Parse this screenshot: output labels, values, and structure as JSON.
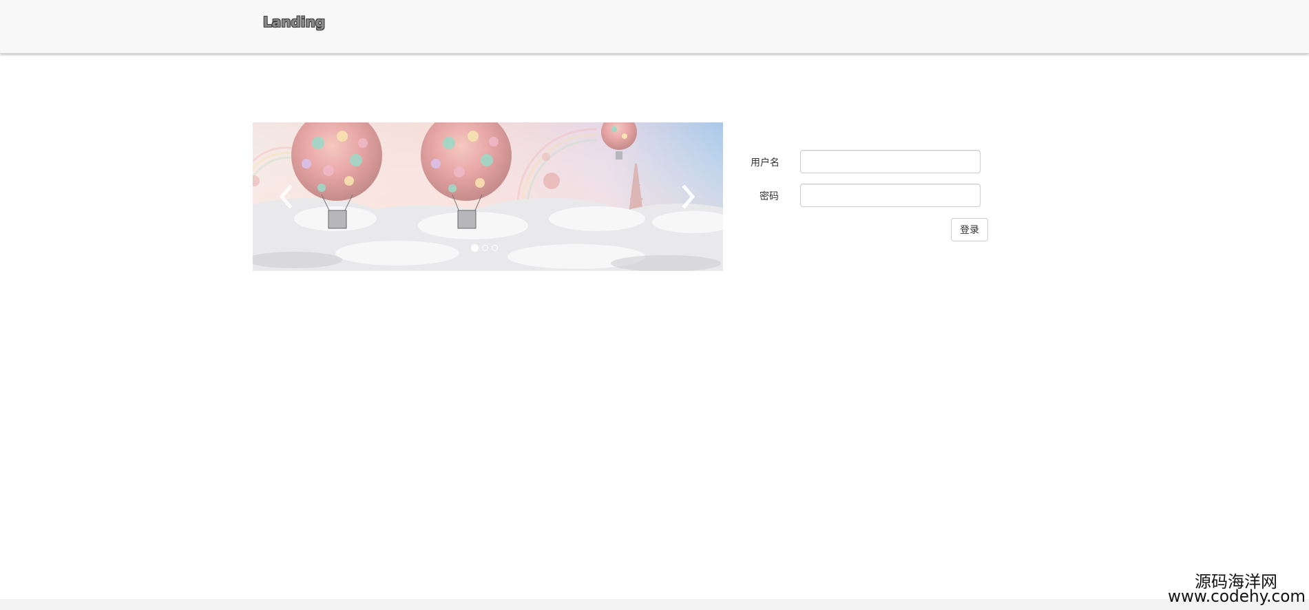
{
  "navbar": {
    "brand": "Landing"
  },
  "carousel": {
    "prev_icon": "chevron-left-icon",
    "next_icon": "chevron-right-icon",
    "slide_count": 3,
    "active_index": 0
  },
  "login": {
    "username_label": "用户名",
    "password_label": "密码",
    "username_value": "",
    "password_value": "",
    "submit_label": "登录"
  },
  "watermark": {
    "text": "源码海洋网 www.codehy.com"
  },
  "colors": {
    "navbar_bg": "#f8f8f8",
    "border": "#cccccc"
  }
}
